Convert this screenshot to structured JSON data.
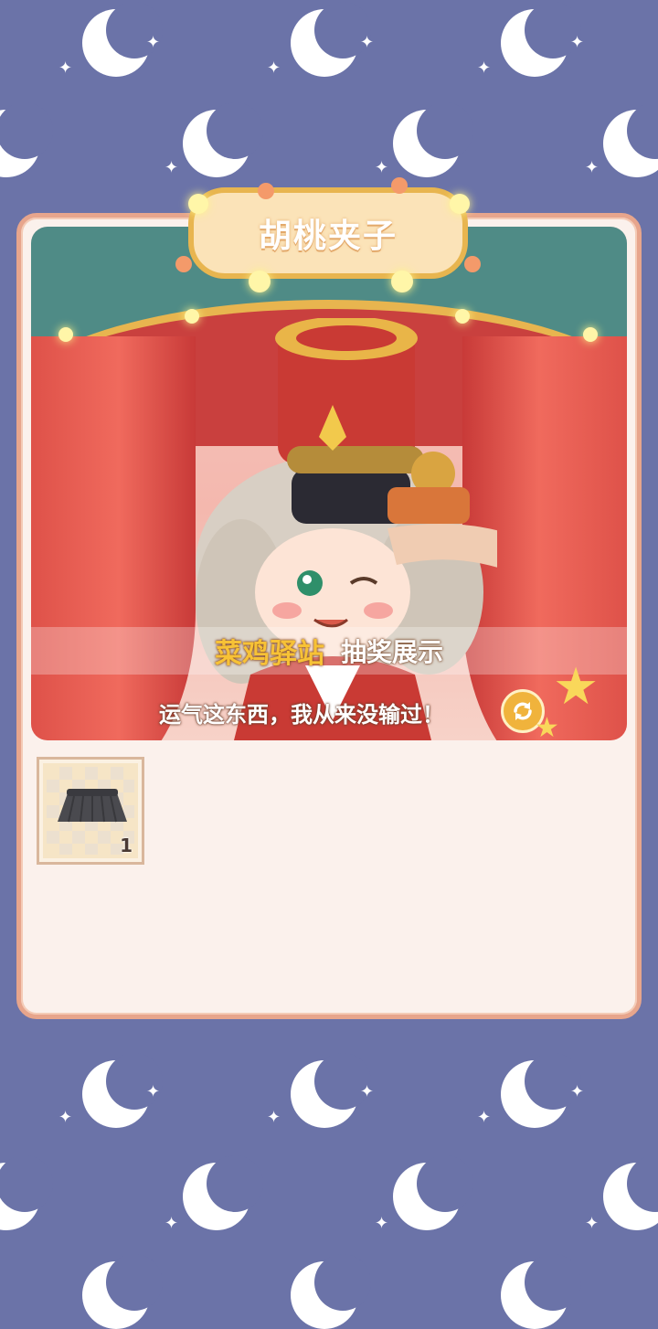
{
  "outfit": {
    "title": "胡桃夹子"
  },
  "banner": {
    "name": "菜鸡驿站",
    "label": "抽奖展示"
  },
  "quote": "运气这东西，我从来没输过！",
  "inventory": [
    {
      "icon": "skirt-icon",
      "count": "1"
    }
  ],
  "colors": {
    "background": "#6b73a8",
    "panel": "#fbf1ec",
    "panel_border": "#e7a58c",
    "banner_name": "#f7c236"
  }
}
